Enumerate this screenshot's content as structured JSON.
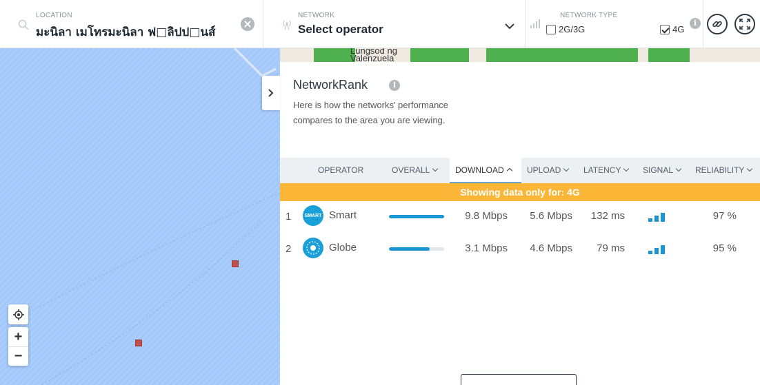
{
  "header": {
    "location": {
      "label": "LOCATION",
      "value": "มะนิลา เมโทรมะนิลา ฟ□ลิปป□นส์"
    },
    "network": {
      "label": "NETWORK",
      "value": "Select operator"
    },
    "network_type": {
      "label": "NETWORK TYPE",
      "options": [
        {
          "label": "2G/3G",
          "checked": false
        },
        {
          "label": "4G",
          "checked": true
        }
      ]
    }
  },
  "map": {
    "labels": [
      "Lungsod ng",
      "Valenzuela"
    ],
    "zoom_in": "+",
    "zoom_out": "−"
  },
  "panel": {
    "title": "NetworkRank",
    "description": "Here is how the networks' performance compares to the area you are viewing.",
    "columns": [
      {
        "label": "OPERATOR",
        "sortable": false,
        "active": false
      },
      {
        "label": "OVERALL",
        "sortable": true,
        "active": false
      },
      {
        "label": "DOWNLOAD",
        "sortable": true,
        "active": true
      },
      {
        "label": "UPLOAD",
        "sortable": true,
        "active": false
      },
      {
        "label": "LATENCY",
        "sortable": true,
        "active": false
      },
      {
        "label": "SIGNAL",
        "sortable": true,
        "active": false
      },
      {
        "label": "RELIABILITY",
        "sortable": true,
        "active": false
      }
    ],
    "banner": "Showing data only for: 4G",
    "rows": [
      {
        "rank": "1",
        "logo_text": "SMART",
        "operator": "Smart",
        "overall": 1.0,
        "download": "9.8 Mbps",
        "upload": "5.6 Mbps",
        "latency": "132 ms",
        "signal_level": 3,
        "reliability": "97 %"
      },
      {
        "rank": "2",
        "logo_text": "",
        "operator": "Globe",
        "overall": 0.74,
        "download": "3.1 Mbps",
        "upload": "4.6 Mbps",
        "latency": "79 ms",
        "signal_level": 3,
        "reliability": "95 %"
      }
    ]
  },
  "colors": {
    "accent": "#1a97d3",
    "banner": "#fbb537",
    "water": "#a3c8fb",
    "urban": "#4fb04f",
    "marker": "#c0504d"
  }
}
